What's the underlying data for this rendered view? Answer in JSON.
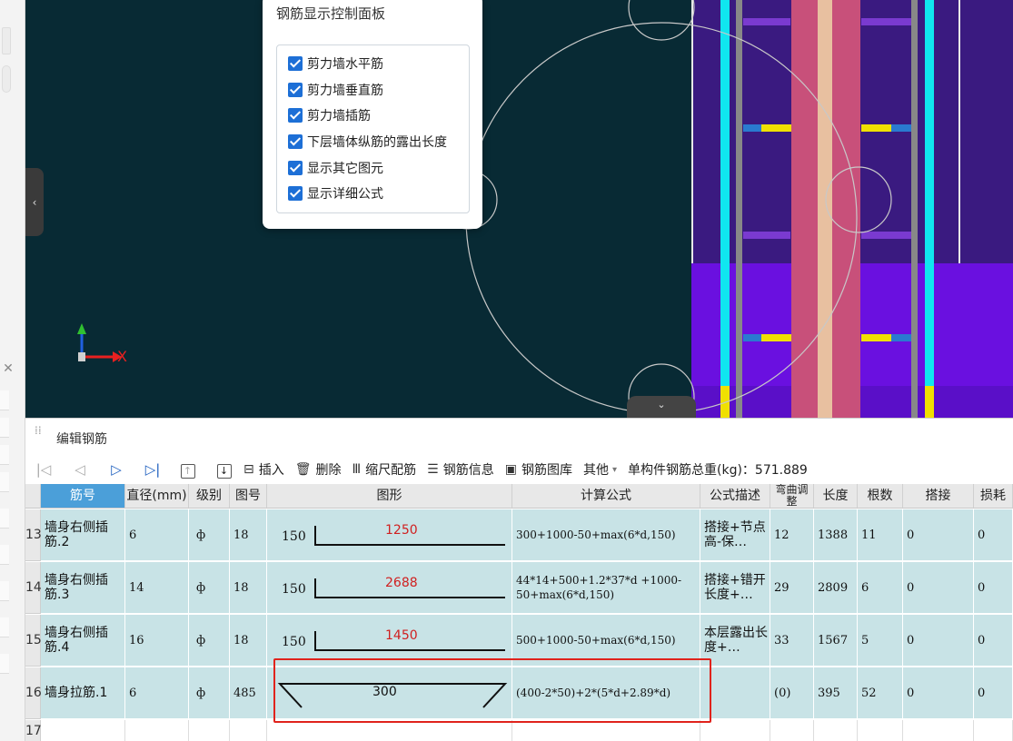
{
  "panel": {
    "title": "钢筋显示控制面板",
    "options": [
      {
        "label": "剪力墙水平筋",
        "checked": true
      },
      {
        "label": "剪力墙垂直筋",
        "checked": true
      },
      {
        "label": "剪力墙插筋",
        "checked": true
      },
      {
        "label": "下层墙体纵筋的露出长度",
        "checked": true
      },
      {
        "label": "显示其它图元",
        "checked": true
      },
      {
        "label": "显示详细公式",
        "checked": true
      }
    ]
  },
  "axis": {
    "x_label": "X"
  },
  "editor": {
    "title": "编辑钢筋",
    "toolbar": {
      "insert": "插入",
      "delete": "删除",
      "scale_rebar": "缩尺配筋",
      "rebar_info": "钢筋信息",
      "rebar_library": "钢筋图库",
      "other": "其他",
      "total_weight": "单构件钢筋总重(kg)：571.889"
    },
    "columns": [
      "筋号",
      "直径(mm)",
      "级别",
      "图号",
      "图形",
      "计算公式",
      "公式描述",
      "弯曲调整",
      "长度",
      "根数",
      "搭接",
      "损耗"
    ],
    "rows": [
      {
        "num": "13",
        "name": "墙身右侧插筋.2",
        "diameter": "6",
        "grade": "ф",
        "fig": "18",
        "shape_left": "150",
        "shape_top": "1250",
        "formula": "300+1000-50+max(6*d,150)",
        "desc": "搭接+节点高-保…",
        "bend": "12",
        "length": "1388",
        "count": "11",
        "lap": "0",
        "loss": "0"
      },
      {
        "num": "14",
        "name": "墙身右侧插筋.3",
        "diameter": "14",
        "grade": "ф",
        "fig": "18",
        "shape_left": "150",
        "shape_top": "2688",
        "formula": "44*14+500+1.2*37*d +1000-50+max(6*d,150)",
        "desc": "搭接+错开长度+…",
        "bend": "29",
        "length": "2809",
        "count": "6",
        "lap": "0",
        "loss": "0"
      },
      {
        "num": "15",
        "name": "墙身右侧插筋.4",
        "diameter": "16",
        "grade": "ф",
        "fig": "18",
        "shape_left": "150",
        "shape_top": "1450",
        "formula": "500+1000-50+max(6*d,150)",
        "desc": "本层露出长度+…",
        "bend": "33",
        "length": "1567",
        "count": "5",
        "lap": "0",
        "loss": "0"
      },
      {
        "num": "16",
        "name": "墙身拉筋.1",
        "diameter": "6",
        "grade": "ф",
        "fig": "485",
        "shape_mid": "300",
        "formula": "(400-2*50)+2*(5*d+2.89*d)",
        "desc": "",
        "bend": "(0)",
        "length": "395",
        "count": "52",
        "lap": "0",
        "loss": "0"
      }
    ],
    "empty_row_num": "17"
  }
}
